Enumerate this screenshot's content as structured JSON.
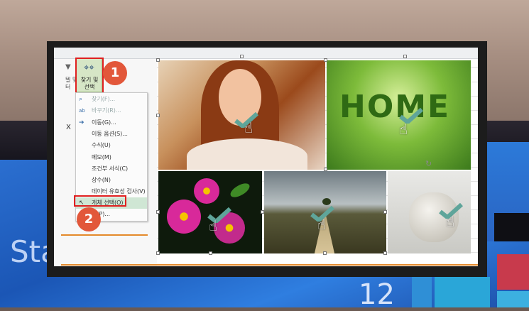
{
  "background": {
    "start_text": "Sta",
    "tile_number": "12"
  },
  "ribbon": {
    "find_select_label": "찾기 및\n선택",
    "find_select_arrow": "▾",
    "left_labels": [
      "텔 및",
      "터",
      "X"
    ]
  },
  "menu": {
    "items": [
      {
        "label": "찾기(F)...",
        "icon": "binoculars-icon",
        "dim": true
      },
      {
        "label": "바꾸기(R)...",
        "icon": "replace-icon",
        "dim": true
      },
      {
        "label": "이동(G)...",
        "icon": "arrow-right-icon",
        "dim": false
      },
      {
        "label": "이동 옵션(S)...",
        "icon": "",
        "dim": false
      },
      {
        "label": "수식(U)",
        "icon": "",
        "dim": false
      },
      {
        "label": "메모(M)",
        "icon": "",
        "dim": false
      },
      {
        "label": "조건부 서식(C)",
        "icon": "",
        "dim": false
      },
      {
        "label": "상수(N)",
        "icon": "",
        "dim": false
      },
      {
        "label": "데이터 유효성 검사(V)",
        "icon": "",
        "dim": false
      },
      {
        "label": "개체 선택(O)",
        "icon": "pointer-icon",
        "dim": false
      },
      {
        "label": "창(P)...",
        "icon": "",
        "dim": false
      }
    ]
  },
  "callouts": {
    "step1": "1",
    "step2": "2"
  },
  "images": {
    "home_text": "HOME"
  },
  "colors": {
    "callout": "#e2573a",
    "highlight_box": "#e02020",
    "check": "#5fa59a",
    "selected_item": "#cfe6d4"
  }
}
